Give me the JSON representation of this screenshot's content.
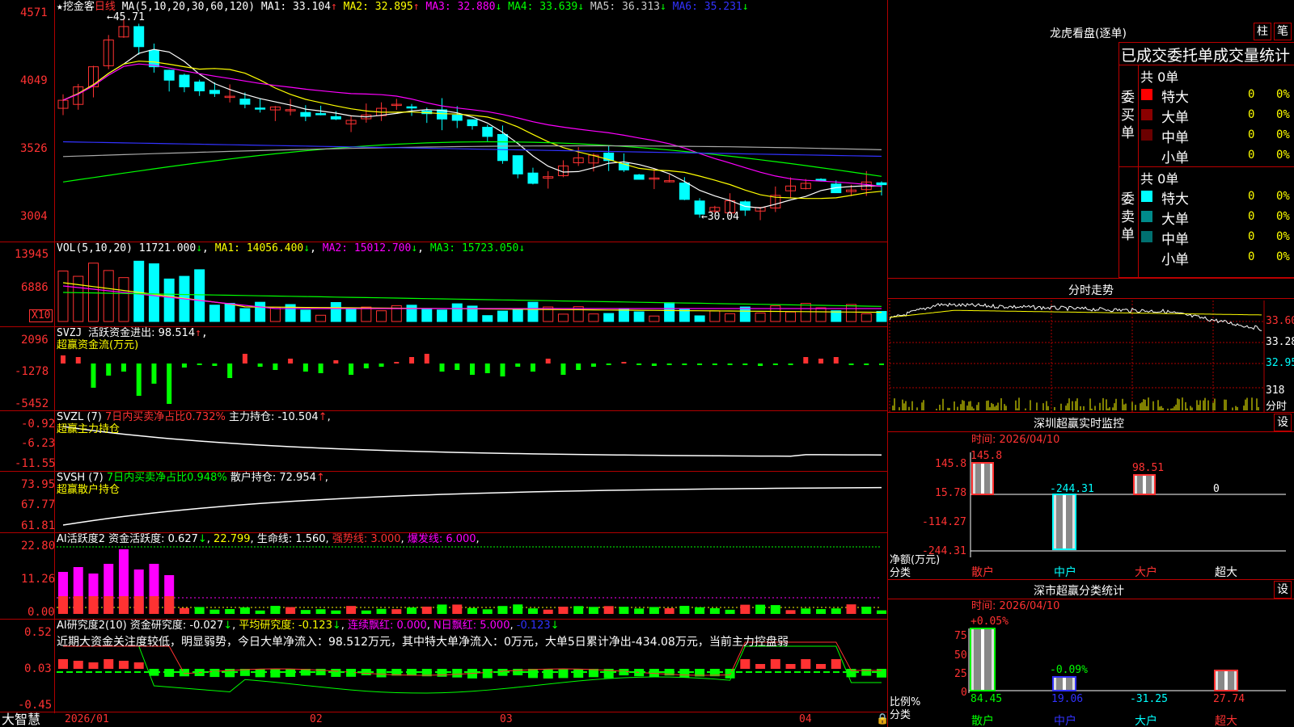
{
  "main_chart": {
    "stock_name": "挖金客",
    "period": "日线",
    "ma_title": "MA(5,10,20,30,60,120)",
    "ma1": "MA1: 33.104",
    "ma2": "MA2: 32.895",
    "ma3": "MA3: 32.880",
    "ma4": "MA4: 33.639",
    "ma5": "MA5: 36.313",
    "ma6": "MA6: 35.231",
    "high_label": "45.71",
    "low_label": "30.04",
    "y_ticks": [
      "4571",
      "4049",
      "3526",
      "3004"
    ]
  },
  "vol_panel": {
    "title": "VOL(5,10,20)",
    "vol": "11721.000",
    "ma1": "MA1: 14056.400",
    "ma2": "MA2: 15012.700",
    "ma3": "MA3: 15723.050",
    "y_ticks": [
      "13945",
      "6886"
    ],
    "unit": "X10"
  },
  "svzj_panel": {
    "title": "SVZJ",
    "desc": "活跃资金进出: 98.514",
    "sub": "超赢资金流(万元)",
    "y_ticks": [
      "2096",
      "-1278",
      "-5452"
    ]
  },
  "svzl_panel": {
    "title": "SVZL (7)",
    "desc1": "7日内买卖净占比0.732%",
    "desc2": "主力持仓: -10.504",
    "sub": "超赢主力持仓",
    "y_ticks": [
      "-0.92",
      "-6.23",
      "-11.55"
    ]
  },
  "svsh_panel": {
    "title": "SVSH (7)",
    "desc1": "7日内买卖净占比0.948%",
    "desc2": "散户持仓: 72.954",
    "sub": "超赢散户持仓",
    "y_ticks": [
      "73.95",
      "67.77",
      "61.81"
    ]
  },
  "ai_active_panel": {
    "title": "AI活跃度2",
    "d1": "资金活跃度: 0.627",
    "d2": "22.799",
    "d3": "生命线: 1.560",
    "d4": "强势线: 3.000",
    "d5": "爆发线: 6.000",
    "y_ticks": [
      "22.80",
      "11.26",
      "0.00"
    ]
  },
  "ai_research_panel": {
    "title": "AI研究度2(10)",
    "d1": "资金研究度: -0.027",
    "d2": "平均研究度: -0.123",
    "d3": "连续飘红: 0.000",
    "d4": "N日飘红: 5.000",
    "d5": "-0.123",
    "summary": "近期大资金关注度较低，明显弱势，今日大单净流入：98.512万元，其中特大单净流入：0万元，大单5日累计净出-434.08万元，当前主力控盘弱",
    "y_ticks": [
      "0.52",
      "0.03",
      "-0.45"
    ]
  },
  "x_axis": {
    "brand": "大智慧",
    "labels": [
      "2026/01",
      "02",
      "03",
      "04"
    ]
  },
  "dragon": {
    "title": "龙虎看盘(逐单)",
    "btn1": "柱",
    "btn2": "笔",
    "header": "已成交委托单成交量统计",
    "buy_label": "委买单",
    "sell_label": "委卖单",
    "buy_total": "共 0单",
    "sell_total": "共 0单",
    "rows": [
      "特大",
      "大单",
      "中单",
      "小单"
    ],
    "zero": "0",
    "pct": "0%",
    "buy_colors": [
      "#ff0000",
      "#8b0000",
      "#6b0000",
      "#000000"
    ],
    "sell_colors": [
      "#00ffff",
      "#008b8b",
      "#007070",
      "#000000"
    ]
  },
  "intraday": {
    "title": "分时走势",
    "prices": [
      "33.60",
      "33.28",
      "32.95"
    ],
    "vol_label": "318",
    "vol_unit": "分时"
  },
  "sz_monitor": {
    "title": "深圳超赢实时监控",
    "btn": "设",
    "time": "时间: 2026/04/10",
    "y_ticks": [
      "145.8",
      "15.78",
      "-114.27",
      "-244.31"
    ],
    "values": [
      "145.8",
      "-244.31",
      "98.51",
      "0"
    ],
    "axis_name": "净额(万元)",
    "axis_cat": "分类",
    "cats": [
      "散户",
      "中户",
      "大户",
      "超大"
    ]
  },
  "market_stats": {
    "title": "深市超赢分类统计",
    "btn": "设",
    "time": "时间: 2026/04/10",
    "y_ticks": [
      "75",
      "50",
      "25",
      "0"
    ],
    "top_labels": [
      "+0.05%",
      "-0.09%"
    ],
    "values": [
      "84.45",
      "19.06",
      "-31.25",
      "27.74"
    ],
    "axis_name": "比例%",
    "axis_cat": "分类",
    "cats": [
      "散户",
      "中户",
      "大户",
      "超大"
    ]
  },
  "colors": {
    "up": "#ff3232",
    "down": "#00ffff",
    "border": "#b00000",
    "ma1": "#ffffff",
    "ma2": "#ffff00",
    "ma3": "#ff00ff",
    "ma4": "#00ff00",
    "ma5": "#aaaaaa",
    "ma6": "#3232ff"
  }
}
